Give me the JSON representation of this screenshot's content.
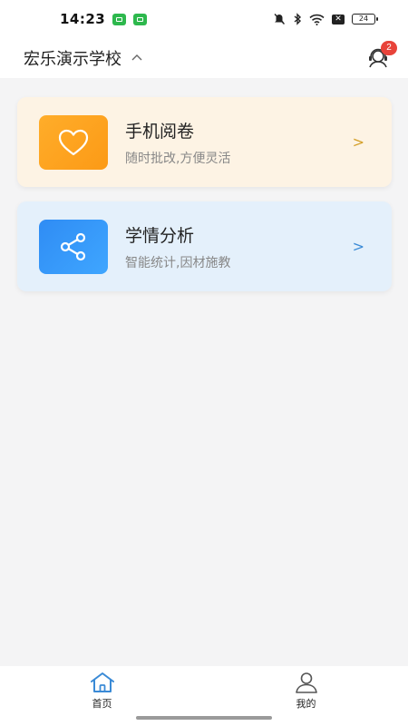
{
  "status_bar": {
    "time": "14:23",
    "battery": "24"
  },
  "header": {
    "school_name": "宏乐演示学校",
    "message_badge": "2"
  },
  "cards": [
    {
      "title": "手机阅卷",
      "subtitle": "随时批改,方便灵活",
      "arrow": ">",
      "icon": "heart-icon",
      "accent": "#fc9a16"
    },
    {
      "title": "学情分析",
      "subtitle": "智能统计,因材施教",
      "arrow": ">",
      "icon": "share-icon",
      "accent": "#2f8cf4"
    }
  ],
  "bottom_nav": {
    "items": [
      {
        "label": "首页",
        "icon": "home-icon",
        "active": true
      },
      {
        "label": "我的",
        "icon": "user-icon",
        "active": false
      }
    ]
  },
  "colors": {
    "background": "#f4f4f5",
    "active_tab": "#3a8ad6",
    "badge": "#e8433a"
  }
}
